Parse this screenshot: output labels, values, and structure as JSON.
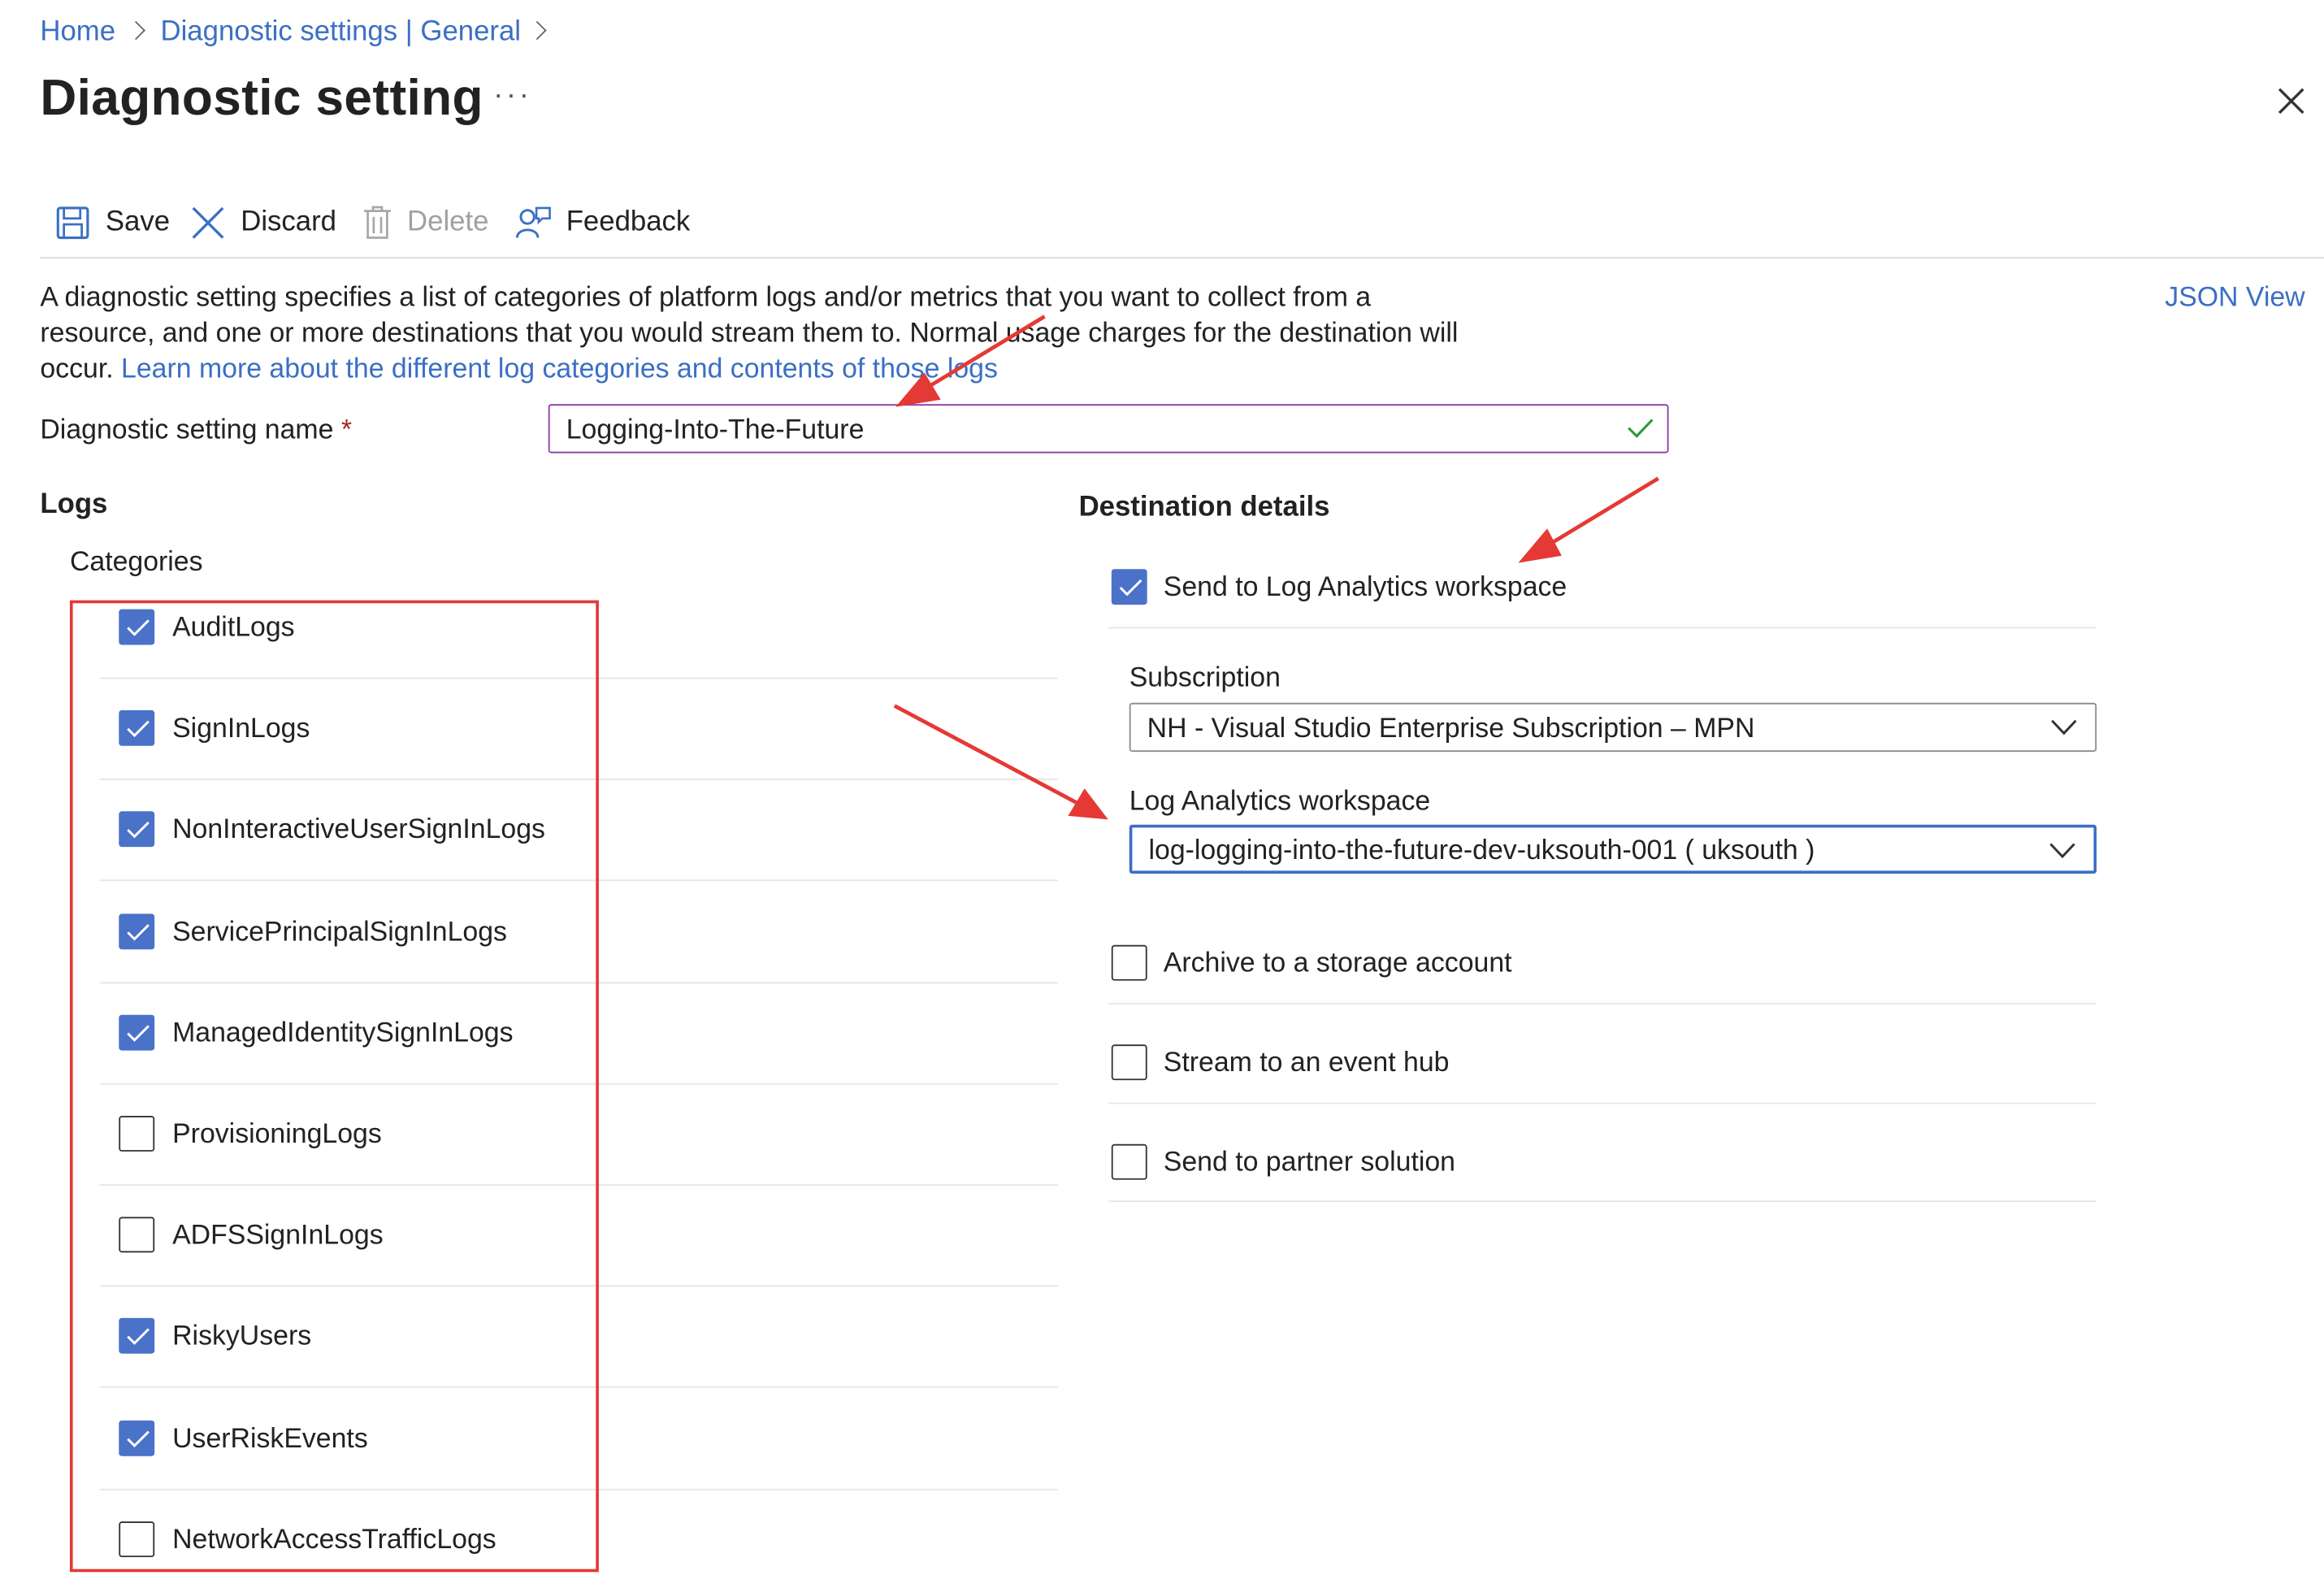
{
  "breadcrumb": {
    "items": [
      "Home",
      "Diagnostic settings | General"
    ]
  },
  "page": {
    "title": "Diagnostic setting",
    "more_label": "···"
  },
  "toolbar": {
    "save_label": "Save",
    "discard_label": "Discard",
    "delete_label": "Delete",
    "feedback_label": "Feedback"
  },
  "description": {
    "text": "A diagnostic setting specifies a list of categories of platform logs and/or metrics that you want to collect from a resource, and one or more destinations that you would stream them to. Normal usage charges for the destination will occur.",
    "link_text": "Learn more about the different log categories and contents of those logs",
    "json_view_label": "JSON View"
  },
  "setting_name": {
    "label": "Diagnostic setting name",
    "required_mark": "*",
    "value": "Logging-Into-The-Future"
  },
  "logs": {
    "heading": "Logs",
    "categories_label": "Categories",
    "categories": [
      {
        "label": "AuditLogs",
        "checked": true
      },
      {
        "label": "SignInLogs",
        "checked": true
      },
      {
        "label": "NonInteractiveUserSignInLogs",
        "checked": true
      },
      {
        "label": "ServicePrincipalSignInLogs",
        "checked": true
      },
      {
        "label": "ManagedIdentitySignInLogs",
        "checked": true
      },
      {
        "label": "ProvisioningLogs",
        "checked": false
      },
      {
        "label": "ADFSSignInLogs",
        "checked": false
      },
      {
        "label": "RiskyUsers",
        "checked": true
      },
      {
        "label": "UserRiskEvents",
        "checked": true
      },
      {
        "label": "NetworkAccessTrafficLogs",
        "checked": false
      }
    ]
  },
  "destination": {
    "heading": "Destination details",
    "log_analytics": {
      "label": "Send to Log Analytics workspace",
      "checked": true
    },
    "subscription": {
      "label": "Subscription",
      "value": "NH - Visual Studio Enterprise Subscription – MPN"
    },
    "workspace": {
      "label": "Log Analytics workspace",
      "value": "log-logging-into-the-future-dev-uksouth-001 ( uksouth )"
    },
    "storage": {
      "label": "Archive to a storage account",
      "checked": false
    },
    "event_hub": {
      "label": "Stream to an event hub",
      "checked": false
    },
    "partner": {
      "label": "Send to partner solution",
      "checked": false
    }
  },
  "colors": {
    "link": "#3b6fc4",
    "checkbox_checked": "#4a72c9",
    "annotation_red": "#e53935",
    "input_border": "#8a3aa8"
  }
}
